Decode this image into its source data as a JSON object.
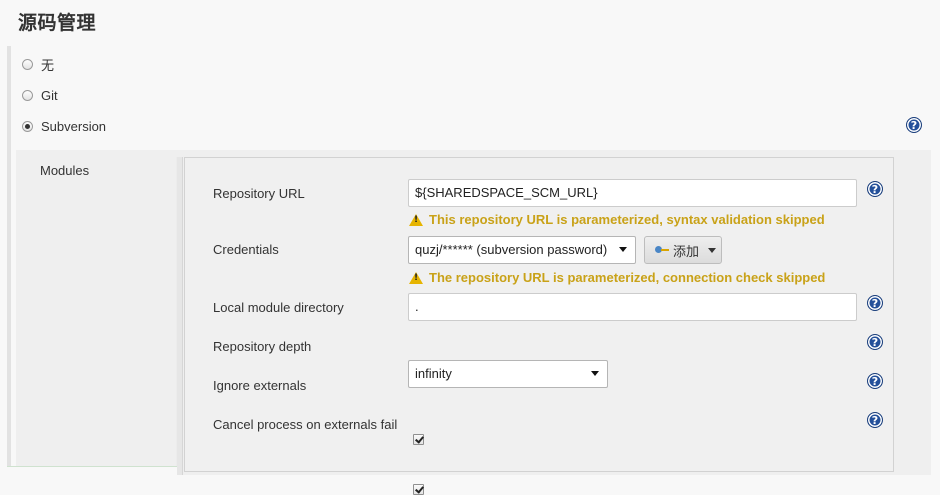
{
  "section": {
    "title": "源码管理"
  },
  "scm_options": [
    {
      "label": "无",
      "selected": false
    },
    {
      "label": "Git",
      "selected": false
    },
    {
      "label": "Subversion",
      "selected": true
    }
  ],
  "modules": {
    "label": "Modules",
    "repository_url": {
      "label": "Repository URL",
      "value": "${SHAREDSPACE_SCM_URL}",
      "warning": "This repository URL is parameterized, syntax validation skipped"
    },
    "credentials": {
      "label": "Credentials",
      "selected": "quzj/****** (subversion password)",
      "add_label": "添加",
      "warning": "The repository URL is parameterized, connection check skipped"
    },
    "local_module_directory": {
      "label": "Local module directory",
      "value": "."
    },
    "repository_depth": {
      "label": "Repository depth",
      "selected": "infinity"
    },
    "ignore_externals": {
      "label": "Ignore externals",
      "checked": true
    },
    "cancel_on_externals_fail": {
      "label": "Cancel process on externals fail",
      "checked": true
    }
  },
  "help_icon_glyph": "?",
  "warning_icon_glyph": "!",
  "colors": {
    "warning": "#c9a218",
    "help": "#24509a"
  }
}
